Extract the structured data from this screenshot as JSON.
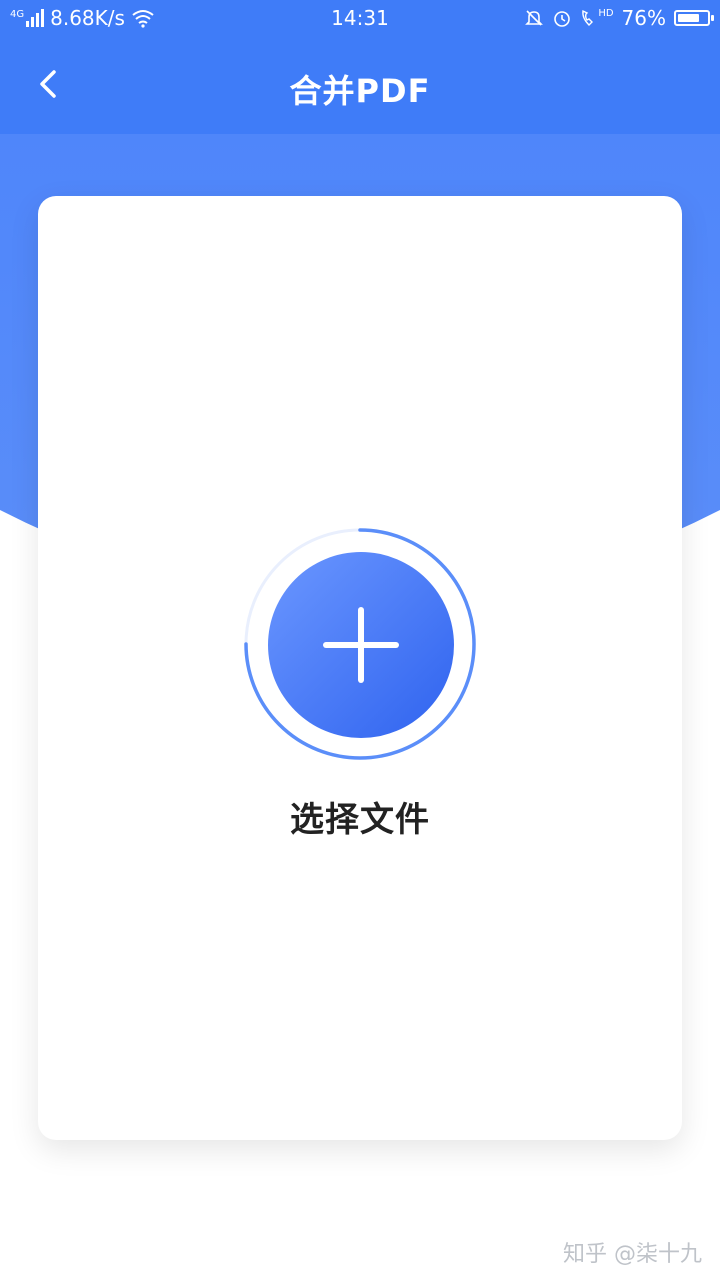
{
  "status_bar": {
    "network": "4G",
    "speed": "8.68K/s",
    "time": "14:31",
    "hd": "HD",
    "battery_text": "76%",
    "battery_level": 0.76
  },
  "header": {
    "title": "合并PDF"
  },
  "main": {
    "select_label": "选择文件"
  },
  "watermark": "知乎 @柒十九",
  "colors": {
    "primary": "#3f7cf8",
    "gradient_start": "#6b97ff",
    "gradient_end": "#2f63ef",
    "text": "#222222"
  }
}
